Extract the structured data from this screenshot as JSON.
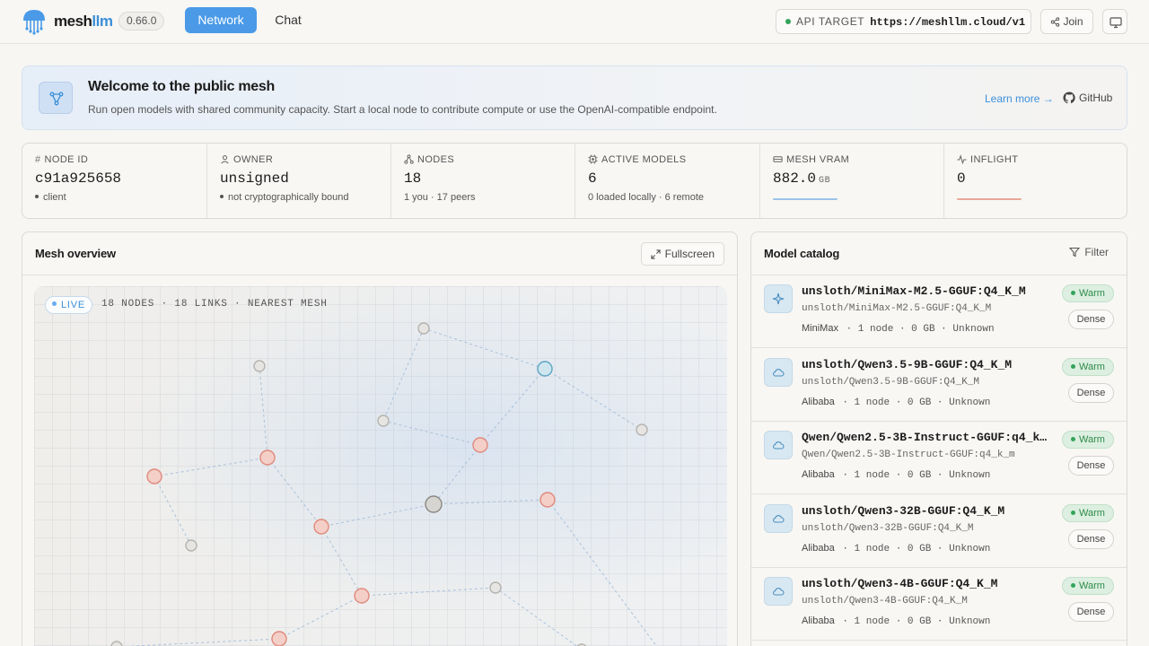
{
  "brand": {
    "name_a": "mesh",
    "name_b": "llm",
    "version": "0.66.0"
  },
  "nav": {
    "network": "Network",
    "chat": "Chat"
  },
  "api": {
    "label": "API TARGET",
    "url": "https://meshllm.cloud/v1"
  },
  "header_buttons": {
    "join": "Join"
  },
  "banner": {
    "title": "Welcome to the public mesh",
    "subtitle": "Run open models with shared community capacity. Start a local node to contribute compute or use the OpenAI-compatible endpoint.",
    "learn_more": "Learn more →",
    "github": "GitHub"
  },
  "stats": [
    {
      "label": "NODE ID",
      "value": "c91a925658",
      "sub": "client",
      "bullet": true
    },
    {
      "label": "OWNER",
      "value": "unsigned",
      "sub": "not cryptographically bound",
      "bullet": true
    },
    {
      "label": "NODES",
      "value": "18",
      "sub": "1 you · 17 peers"
    },
    {
      "label": "ACTIVE MODELS",
      "value": "6",
      "sub": "0 loaded locally · 6 remote"
    },
    {
      "label": "MESH VRAM",
      "value": "882.0",
      "unit": "GB"
    },
    {
      "label": "INFLIGHT",
      "value": "0"
    }
  ],
  "colors": {
    "accent": "#4a9ae8",
    "warm": "#34a35b",
    "vram_bar": "#9cc3ea",
    "inflight_bar": "#e8a898"
  },
  "mesh": {
    "title": "Mesh overview",
    "fullscreen": "Fullscreen",
    "live": "LIVE",
    "meta": "18 NODES · 18 LINKS · NEAREST MESH"
  },
  "catalog": {
    "title": "Model catalog",
    "filter": "Filter",
    "models": [
      {
        "name": "unsloth/MiniMax-M2.5-GGUF:Q4_K_M",
        "id": "unsloth/MiniMax-M2.5-GGUF:Q4_K_M",
        "vendor": "MiniMax",
        "stats": "· 1 node · 0 GB · Unknown",
        "status": "Warm",
        "kind": "Dense",
        "icon": "sparkle-icon"
      },
      {
        "name": "unsloth/Qwen3.5-9B-GGUF:Q4_K_M",
        "id": "unsloth/Qwen3.5-9B-GGUF:Q4_K_M",
        "vendor": "Alibaba",
        "stats": "· 1 node · 0 GB · Unknown",
        "status": "Warm",
        "kind": "Dense",
        "icon": "cloud-icon"
      },
      {
        "name": "Qwen/Qwen2.5-3B-Instruct-GGUF:q4_k_m",
        "id": "Qwen/Qwen2.5-3B-Instruct-GGUF:q4_k_m",
        "vendor": "Alibaba",
        "stats": "· 1 node · 0 GB · Unknown",
        "status": "Warm",
        "kind": "Dense",
        "icon": "cloud-icon"
      },
      {
        "name": "unsloth/Qwen3-32B-GGUF:Q4_K_M",
        "id": "unsloth/Qwen3-32B-GGUF:Q4_K_M",
        "vendor": "Alibaba",
        "stats": "· 1 node · 0 GB · Unknown",
        "status": "Warm",
        "kind": "Dense",
        "icon": "cloud-icon"
      },
      {
        "name": "unsloth/Qwen3-4B-GGUF:Q4_K_M",
        "id": "unsloth/Qwen3-4B-GGUF:Q4_K_M",
        "vendor": "Alibaba",
        "stats": "· 1 node · 0 GB · Unknown",
        "status": "Warm",
        "kind": "Dense",
        "icon": "cloud-icon"
      }
    ]
  }
}
